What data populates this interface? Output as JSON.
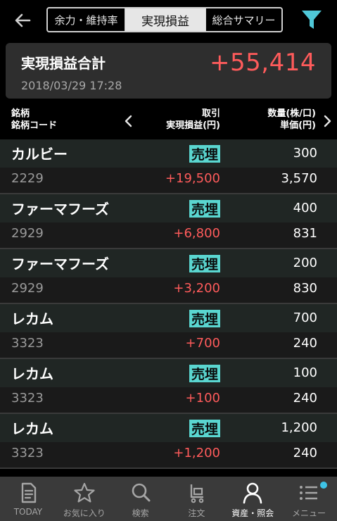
{
  "header": {
    "tabs": [
      {
        "label": "余力・維持率",
        "active": false
      },
      {
        "label": "実現損益",
        "active": true
      },
      {
        "label": "総合サマリー",
        "active": false
      }
    ],
    "filter_color": "#4fc8d8"
  },
  "summary": {
    "label": "実現損益合計",
    "value": "+55,414",
    "datetime": "2018/03/29  17:28"
  },
  "columns": {
    "col1_line1": "銘柄",
    "col1_line2": "銘柄コード",
    "col2_line1": "取引",
    "col2_line2": "実現損益(円)",
    "col3_line1": "数量(株/口)",
    "col3_line2": "単価(円)"
  },
  "rows": [
    {
      "name": "カルビー",
      "code": "2229",
      "side": "売埋",
      "pl": "+19,500",
      "qty": "300",
      "price": "3,570"
    },
    {
      "name": "ファーマフーズ",
      "code": "2929",
      "side": "売埋",
      "pl": "+6,800",
      "qty": "400",
      "price": "831"
    },
    {
      "name": "ファーマフーズ",
      "code": "2929",
      "side": "売埋",
      "pl": "+3,200",
      "qty": "200",
      "price": "830"
    },
    {
      "name": "レカム",
      "code": "3323",
      "side": "売埋",
      "pl": "+700",
      "qty": "700",
      "price": "240"
    },
    {
      "name": "レカム",
      "code": "3323",
      "side": "売埋",
      "pl": "+100",
      "qty": "100",
      "price": "240"
    },
    {
      "name": "レカム",
      "code": "3323",
      "side": "売埋",
      "pl": "+1,200",
      "qty": "1,200",
      "price": "240"
    }
  ],
  "nav": [
    {
      "label": "TODAY",
      "icon": "today-icon"
    },
    {
      "label": "お気に入り",
      "icon": "star-icon"
    },
    {
      "label": "検索",
      "icon": "search-icon"
    },
    {
      "label": "注文",
      "icon": "cart-icon"
    },
    {
      "label": "資産・照会",
      "icon": "person-icon",
      "active": true
    },
    {
      "label": "メニュー",
      "icon": "menu-icon"
    }
  ],
  "colors": {
    "profit": "#ff5b5b",
    "side_badge": "#5ad6d0",
    "accent_dot": "#3ec3e6"
  }
}
